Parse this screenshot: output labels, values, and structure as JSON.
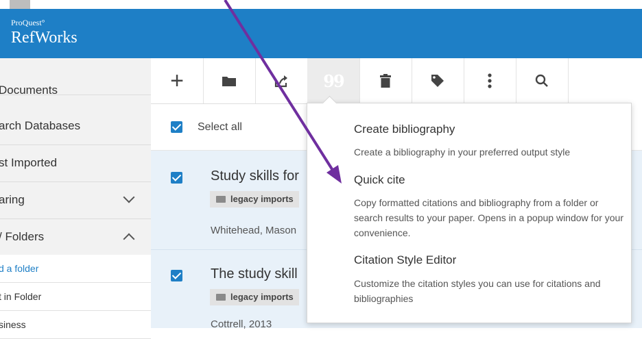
{
  "header": {
    "brand_small": "ProQuest°",
    "brand_big": "RefWorks"
  },
  "sidebar": {
    "items": [
      {
        "label": "Documents"
      },
      {
        "label": "arch Databases"
      },
      {
        "label": "st Imported"
      },
      {
        "label": "aring"
      },
      {
        "label": "/ Folders"
      }
    ],
    "subitems": [
      {
        "label": "d a folder"
      },
      {
        "label": "t in Folder"
      },
      {
        "label": "siness"
      }
    ]
  },
  "toolbar": {
    "add_icon": "+",
    "quote_icon": "99"
  },
  "list": {
    "select_all": "Select all",
    "rows": [
      {
        "title": "Study skills for",
        "tag": "legacy imports",
        "meta": "Whitehead, Mason"
      },
      {
        "title": "The study skill",
        "tag": "legacy imports",
        "meta": "Cottrell, 2013"
      }
    ]
  },
  "cite_menu": {
    "items": [
      {
        "title": "Create bibliography",
        "desc": "Create a bibliography in your preferred output style"
      },
      {
        "title": "Quick cite",
        "desc": "Copy formatted citations and bibliography from a folder or search results to your paper. Opens in a popup window for your convenience."
      },
      {
        "title": "Citation Style Editor",
        "desc": "Customize the citation styles you can use for citations and bibliographies"
      }
    ]
  },
  "colors": {
    "brand_blue": "#1e7fc6",
    "annotation_arrow": "#6f2f9f"
  }
}
